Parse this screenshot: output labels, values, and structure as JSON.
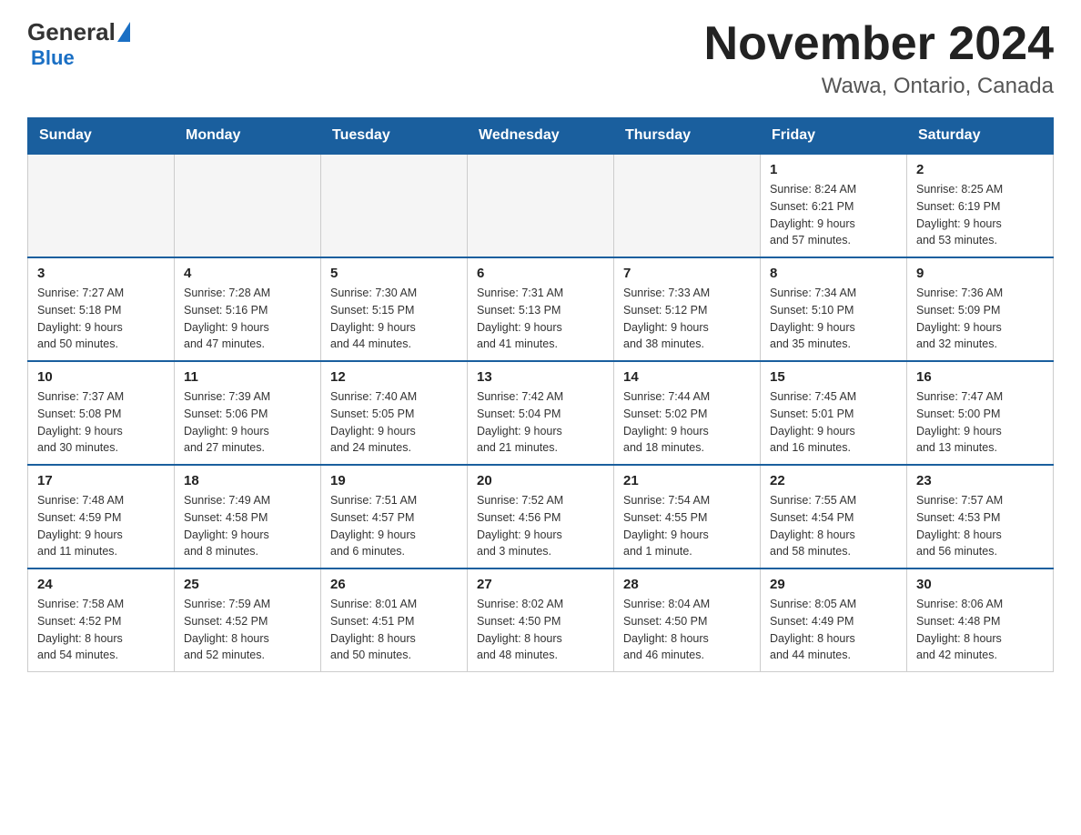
{
  "header": {
    "logo_general": "General",
    "logo_blue": "Blue",
    "title": "November 2024",
    "subtitle": "Wawa, Ontario, Canada"
  },
  "days_of_week": [
    "Sunday",
    "Monday",
    "Tuesday",
    "Wednesday",
    "Thursday",
    "Friday",
    "Saturday"
  ],
  "weeks": [
    [
      {
        "day": "",
        "info": ""
      },
      {
        "day": "",
        "info": ""
      },
      {
        "day": "",
        "info": ""
      },
      {
        "day": "",
        "info": ""
      },
      {
        "day": "",
        "info": ""
      },
      {
        "day": "1",
        "info": "Sunrise: 8:24 AM\nSunset: 6:21 PM\nDaylight: 9 hours\nand 57 minutes."
      },
      {
        "day": "2",
        "info": "Sunrise: 8:25 AM\nSunset: 6:19 PM\nDaylight: 9 hours\nand 53 minutes."
      }
    ],
    [
      {
        "day": "3",
        "info": "Sunrise: 7:27 AM\nSunset: 5:18 PM\nDaylight: 9 hours\nand 50 minutes."
      },
      {
        "day": "4",
        "info": "Sunrise: 7:28 AM\nSunset: 5:16 PM\nDaylight: 9 hours\nand 47 minutes."
      },
      {
        "day": "5",
        "info": "Sunrise: 7:30 AM\nSunset: 5:15 PM\nDaylight: 9 hours\nand 44 minutes."
      },
      {
        "day": "6",
        "info": "Sunrise: 7:31 AM\nSunset: 5:13 PM\nDaylight: 9 hours\nand 41 minutes."
      },
      {
        "day": "7",
        "info": "Sunrise: 7:33 AM\nSunset: 5:12 PM\nDaylight: 9 hours\nand 38 minutes."
      },
      {
        "day": "8",
        "info": "Sunrise: 7:34 AM\nSunset: 5:10 PM\nDaylight: 9 hours\nand 35 minutes."
      },
      {
        "day": "9",
        "info": "Sunrise: 7:36 AM\nSunset: 5:09 PM\nDaylight: 9 hours\nand 32 minutes."
      }
    ],
    [
      {
        "day": "10",
        "info": "Sunrise: 7:37 AM\nSunset: 5:08 PM\nDaylight: 9 hours\nand 30 minutes."
      },
      {
        "day": "11",
        "info": "Sunrise: 7:39 AM\nSunset: 5:06 PM\nDaylight: 9 hours\nand 27 minutes."
      },
      {
        "day": "12",
        "info": "Sunrise: 7:40 AM\nSunset: 5:05 PM\nDaylight: 9 hours\nand 24 minutes."
      },
      {
        "day": "13",
        "info": "Sunrise: 7:42 AM\nSunset: 5:04 PM\nDaylight: 9 hours\nand 21 minutes."
      },
      {
        "day": "14",
        "info": "Sunrise: 7:44 AM\nSunset: 5:02 PM\nDaylight: 9 hours\nand 18 minutes."
      },
      {
        "day": "15",
        "info": "Sunrise: 7:45 AM\nSunset: 5:01 PM\nDaylight: 9 hours\nand 16 minutes."
      },
      {
        "day": "16",
        "info": "Sunrise: 7:47 AM\nSunset: 5:00 PM\nDaylight: 9 hours\nand 13 minutes."
      }
    ],
    [
      {
        "day": "17",
        "info": "Sunrise: 7:48 AM\nSunset: 4:59 PM\nDaylight: 9 hours\nand 11 minutes."
      },
      {
        "day": "18",
        "info": "Sunrise: 7:49 AM\nSunset: 4:58 PM\nDaylight: 9 hours\nand 8 minutes."
      },
      {
        "day": "19",
        "info": "Sunrise: 7:51 AM\nSunset: 4:57 PM\nDaylight: 9 hours\nand 6 minutes."
      },
      {
        "day": "20",
        "info": "Sunrise: 7:52 AM\nSunset: 4:56 PM\nDaylight: 9 hours\nand 3 minutes."
      },
      {
        "day": "21",
        "info": "Sunrise: 7:54 AM\nSunset: 4:55 PM\nDaylight: 9 hours\nand 1 minute."
      },
      {
        "day": "22",
        "info": "Sunrise: 7:55 AM\nSunset: 4:54 PM\nDaylight: 8 hours\nand 58 minutes."
      },
      {
        "day": "23",
        "info": "Sunrise: 7:57 AM\nSunset: 4:53 PM\nDaylight: 8 hours\nand 56 minutes."
      }
    ],
    [
      {
        "day": "24",
        "info": "Sunrise: 7:58 AM\nSunset: 4:52 PM\nDaylight: 8 hours\nand 54 minutes."
      },
      {
        "day": "25",
        "info": "Sunrise: 7:59 AM\nSunset: 4:52 PM\nDaylight: 8 hours\nand 52 minutes."
      },
      {
        "day": "26",
        "info": "Sunrise: 8:01 AM\nSunset: 4:51 PM\nDaylight: 8 hours\nand 50 minutes."
      },
      {
        "day": "27",
        "info": "Sunrise: 8:02 AM\nSunset: 4:50 PM\nDaylight: 8 hours\nand 48 minutes."
      },
      {
        "day": "28",
        "info": "Sunrise: 8:04 AM\nSunset: 4:50 PM\nDaylight: 8 hours\nand 46 minutes."
      },
      {
        "day": "29",
        "info": "Sunrise: 8:05 AM\nSunset: 4:49 PM\nDaylight: 8 hours\nand 44 minutes."
      },
      {
        "day": "30",
        "info": "Sunrise: 8:06 AM\nSunset: 4:48 PM\nDaylight: 8 hours\nand 42 minutes."
      }
    ]
  ]
}
